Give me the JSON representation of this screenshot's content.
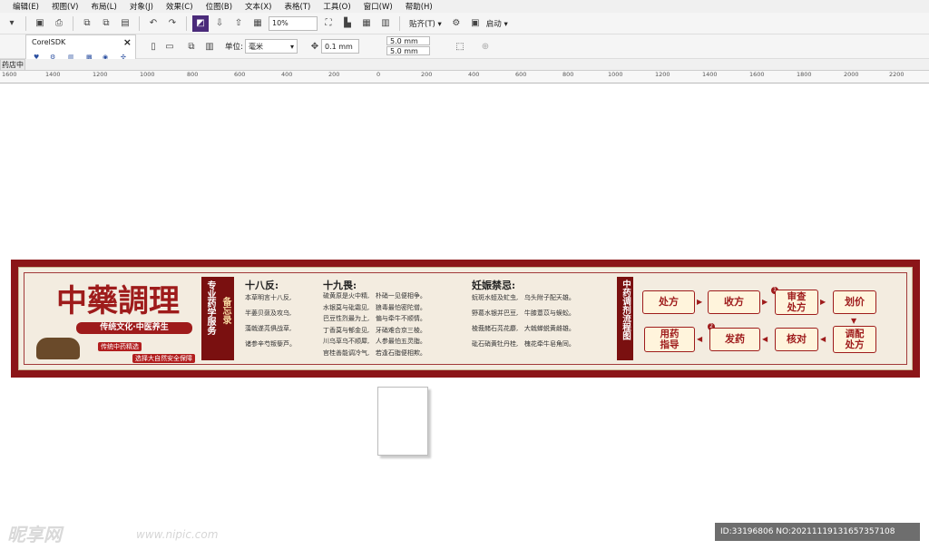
{
  "menu": [
    "编辑(E)",
    "视图(V)",
    "布局(L)",
    "对象(J)",
    "效果(C)",
    "位图(B)",
    "文本(X)",
    "表格(T)",
    "工具(O)",
    "窗口(W)",
    "帮助(H)"
  ],
  "toolbar": {
    "zoom": "10%",
    "snap": "贴齐(T)",
    "launch": "启动",
    "unit_label": "单位:",
    "unit": "毫米",
    "nudge": "0.1 mm",
    "dup_x": "5.0 mm",
    "dup_y": "5.0 mm"
  },
  "sdk": {
    "title": "CorelSDK",
    "close": "×"
  },
  "doc_tab": "药店中",
  "ruler": [
    "1600",
    "1400",
    "1200",
    "1000",
    "800",
    "600",
    "400",
    "200",
    "0",
    "200",
    "400",
    "600",
    "800",
    "1000",
    "1200",
    "1400",
    "1600",
    "1800",
    "2000",
    "2200"
  ],
  "banner": {
    "title": "中藥調理",
    "subtitle": "传统文化·中医养生",
    "tag1": "传统中药精选",
    "tag2": "选择大自然安全保障",
    "memo_a": "专业药学服务",
    "memo_b": "备忘录",
    "col1_title": "十八反:",
    "col1": "本草明言十八反,\n半蒌贝蔹及攻乌,\n藻戟遂芫俱战草,\n诸参辛芍叛藜芦。",
    "col2_title": "十九畏:",
    "col2": "硫黄原是火中精,   朴硝一见便相争。\n水银莫与砒霜见,   狼毒最怕密陀僧。\n巴豆性烈最为上,   偏与牵牛不顺情。\n丁香莫与郁金见,   牙硝难合京三棱。\n川乌草乌不顺犀,   人参最怕五灵脂。\n官桂善能调冷气,   若逢石脂便相欺。",
    "col3_title": "妊娠禁忌:",
    "col3": "蚖斑水蛭及虻虫,   乌头附子配天雄。\n野葛水银并巴豆,   牛膝薏苡与蜈蚣。\n棱莪赭石芫花麝,   大戟蝉蜕黄雌雄。\n砒石硝黄牡丹桂,   槐花牵牛皂角同。",
    "flow_title": "中药调剂流程图",
    "flow": {
      "b1": "处方",
      "b2": "收方",
      "b3": "审查处方",
      "b4": "划价",
      "b5": "用药指导",
      "b6": "发药",
      "b7": "核对",
      "b8": "调配处方",
      "n1": "1",
      "n2": "2"
    }
  },
  "watermark": {
    "logo": "昵享网",
    "url": "www.nipic.com",
    "id": "ID:33196806 NO:20211119131657357108"
  }
}
